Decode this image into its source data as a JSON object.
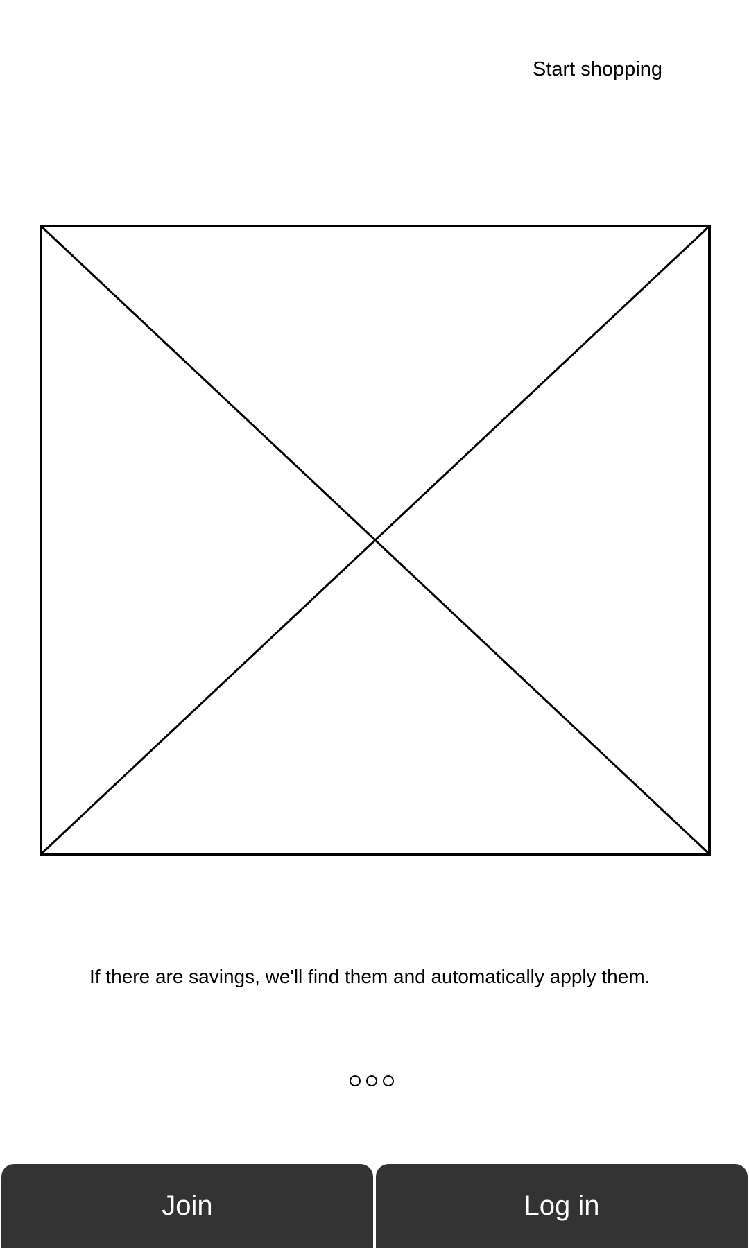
{
  "header": {
    "start_shopping_label": "Start shopping"
  },
  "hero": {
    "icon": "image-placeholder-icon"
  },
  "onboarding": {
    "tagline": "If there are savings, we'll find them and automatically apply them.",
    "pager": {
      "total": 3
    }
  },
  "actions": {
    "join_label": "Join",
    "login_label": "Log in"
  },
  "colors": {
    "background": "#ffffff",
    "text": "#000000",
    "button_bg": "#333333",
    "button_text": "#ffffff"
  }
}
